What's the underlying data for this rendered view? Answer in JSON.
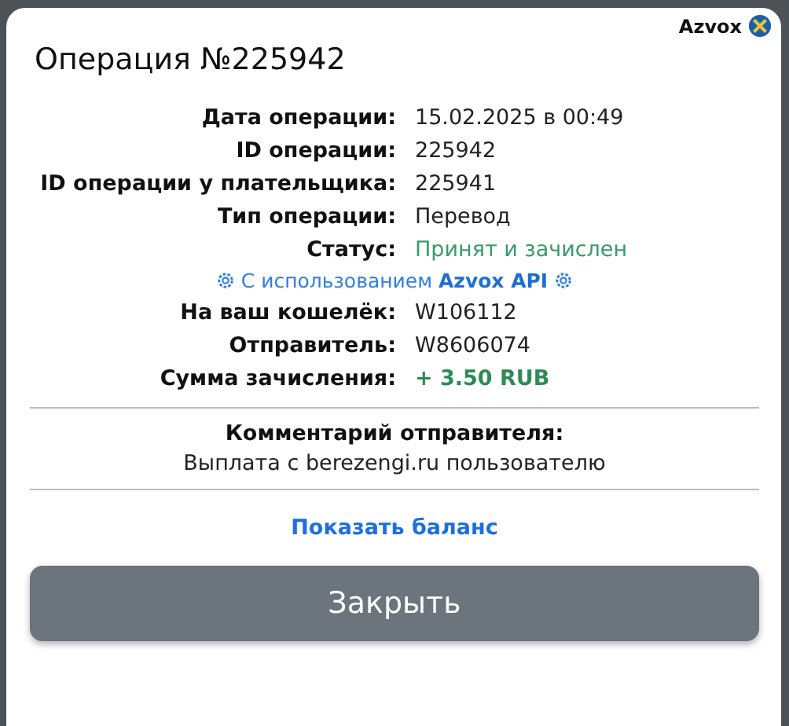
{
  "brand": {
    "name": "Azvox"
  },
  "title": "Операция №225942",
  "details": [
    {
      "label": "Дата операции:",
      "value": "15.02.2025 в 00:49",
      "kind": "plain"
    },
    {
      "label": "ID операции:",
      "value": "225942",
      "kind": "plain"
    },
    {
      "label": "ID операции у плательщика:",
      "value": "225941",
      "kind": "plain"
    },
    {
      "label": "Тип операции:",
      "value": "Перевод",
      "kind": "plain"
    },
    {
      "label": "Статус:",
      "value": "Принят и зачислен",
      "kind": "status"
    }
  ],
  "api_note": "С использованием **Azvox API**",
  "details_2": [
    {
      "label": "На ваш кошелёк:",
      "value": "W106112",
      "kind": "plain"
    },
    {
      "label": "Отправитель:",
      "value": "W8606074",
      "kind": "plain"
    },
    {
      "label": "Сумма зачисления:",
      "value": "+ 3.50 RUB",
      "kind": "amount"
    }
  ],
  "comment": {
    "label": "Комментарий отправителя:",
    "text": "Выплата с berezengi.ru пользователю"
  },
  "balance_link": "Показать баланс",
  "close_button": "Закрыть"
}
